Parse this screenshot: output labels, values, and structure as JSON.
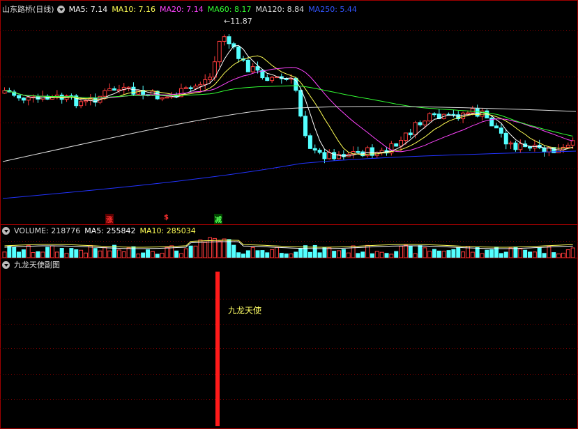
{
  "stock": {
    "name": "山东路桥",
    "period": "(日线)"
  },
  "ma_legend": [
    {
      "label": "MA5: 7.14",
      "color": "#ffffff"
    },
    {
      "label": "MA10: 7.16",
      "color": "#ffff55"
    },
    {
      "label": "MA20: 7.14",
      "color": "#ff44ff"
    },
    {
      "label": "MA60: 8.17",
      "color": "#33ff33"
    },
    {
      "label": "MA120: 8.84",
      "color": "#dddddd"
    },
    {
      "label": "MA250: 5.44",
      "color": "#3355ff"
    }
  ],
  "high_marker": "11.87",
  "signals": [
    {
      "label": "涨",
      "color": "#ff3030",
      "bg": "#5a0000"
    },
    {
      "label": "$",
      "color": "#ff3030",
      "bg": "#000000"
    },
    {
      "label": "减",
      "color": "#55ff55",
      "bg": "#004400"
    }
  ],
  "volume_legend": [
    {
      "label": "VOLUME: 218776",
      "color": "#dddddd"
    },
    {
      "label": "MA5: 255842",
      "color": "#ffffff"
    },
    {
      "label": "MA10: 285034",
      "color": "#ffff55"
    }
  ],
  "sub_panel": {
    "title": "九龙天使副图",
    "indicator_label": "九龙天使",
    "indicator_color": "#ffff66",
    "bar_color": "#ff1a1a"
  },
  "colors": {
    "up": "#ff3c3c",
    "down": "#54ffff",
    "grid": "#8b0000",
    "border": "#b00000"
  }
}
